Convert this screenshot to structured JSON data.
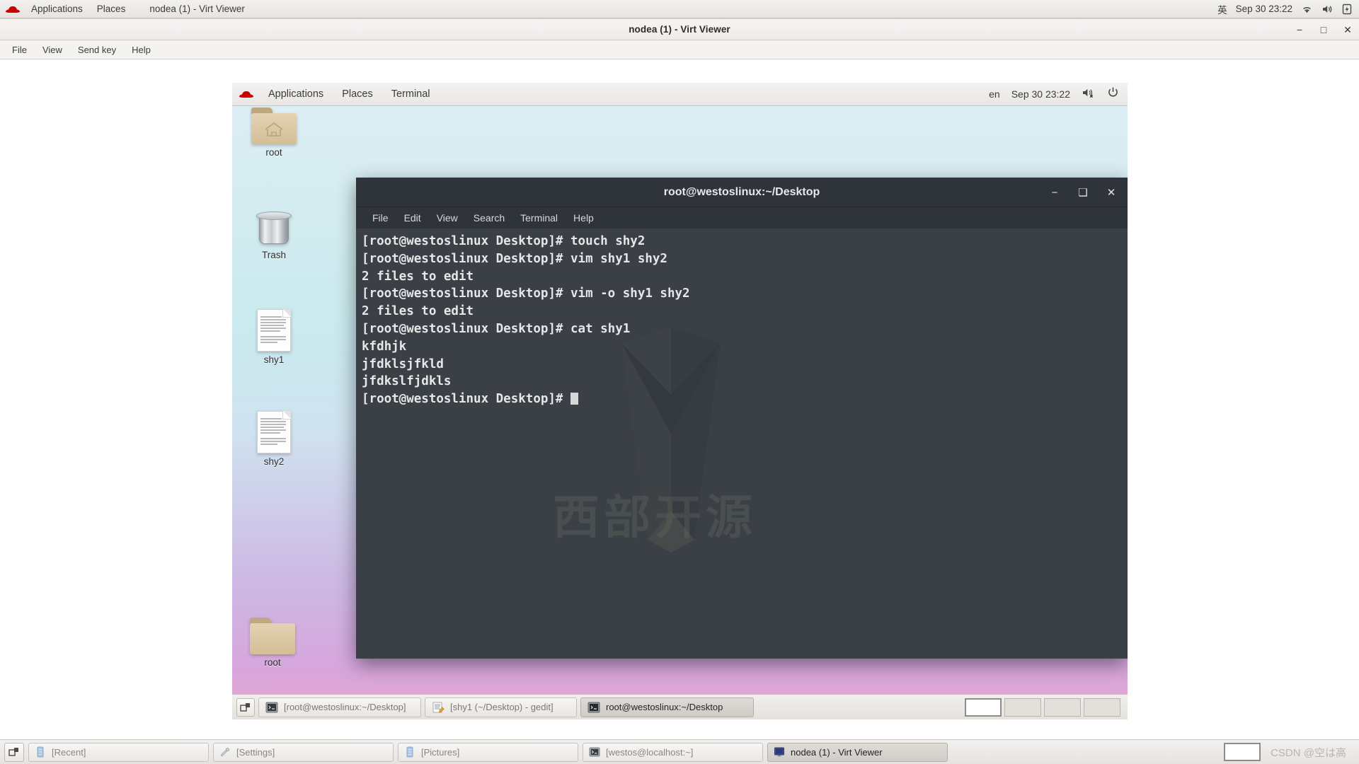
{
  "host": {
    "top_panel": {
      "logo": "redhat-logo",
      "menus": [
        "Applications",
        "Places"
      ],
      "window_title": "nodea (1) - Virt Viewer",
      "tray": {
        "input_method": "英",
        "clock": "Sep 30  23:22",
        "icons": [
          "wifi-icon",
          "volume-icon",
          "battery-icon"
        ]
      }
    },
    "taskbar": {
      "show_desktop": "show-desktop-icon",
      "tasks": [
        {
          "label": "[Recent]",
          "icon": "files-icon",
          "active": false
        },
        {
          "label": "[Settings]",
          "icon": "settings-icon",
          "active": false
        },
        {
          "label": "[Pictures]",
          "icon": "files-icon",
          "active": false
        },
        {
          "label": "[westos@localhost:~]",
          "icon": "terminal-icon",
          "active": false
        },
        {
          "label": "nodea (1) - Virt Viewer",
          "icon": "virt-viewer-icon",
          "active": true
        }
      ],
      "workspace_label": "",
      "watermark": "CSDN @空は高"
    }
  },
  "virt_viewer": {
    "title": "nodea (1) - Virt Viewer",
    "window_buttons": {
      "minimize": "−",
      "maximize": "□",
      "close": "✕"
    },
    "menus": [
      "File",
      "View",
      "Send key",
      "Help"
    ]
  },
  "vm": {
    "panel": {
      "logo": "redhat-logo",
      "menus": [
        "Applications",
        "Places",
        "Terminal"
      ],
      "tray": {
        "keyboard_layout": "en",
        "clock": "Sep 30  23:22",
        "icons": [
          "volume-muted-icon",
          "power-icon"
        ]
      }
    },
    "desktop_icons": [
      {
        "name": "root",
        "type": "home-folder-icon"
      },
      {
        "name": "Trash",
        "type": "trash-icon"
      },
      {
        "name": "shy1",
        "type": "document-icon"
      },
      {
        "name": "shy2",
        "type": "document-icon"
      },
      {
        "name": "root",
        "type": "folder-icon"
      }
    ],
    "taskbar": {
      "show_desktop": "show-desktop-icon",
      "tasks": [
        {
          "label": "[root@westoslinux:~/Desktop]",
          "icon": "terminal-icon",
          "active": false
        },
        {
          "label": "[shy1 (~/Desktop) - gedit]",
          "icon": "gedit-icon",
          "active": false
        },
        {
          "label": "root@westoslinux:~/Desktop",
          "icon": "terminal-icon",
          "active": true
        }
      ],
      "workspaces": [
        {
          "active": true
        },
        {
          "active": false
        },
        {
          "active": false
        },
        {
          "active": false
        }
      ]
    }
  },
  "terminal": {
    "title": "root@westoslinux:~/Desktop",
    "window_buttons": {
      "minimize": "−",
      "maximize": "❑",
      "close": "✕"
    },
    "menus": [
      "File",
      "Edit",
      "View",
      "Search",
      "Terminal",
      "Help"
    ],
    "watermark_text": "西部开源",
    "prompt": "[root@westoslinux Desktop]# ",
    "lines": [
      {
        "type": "prompt",
        "command": "touch shy2"
      },
      {
        "type": "prompt",
        "command": "vim shy1 shy2"
      },
      {
        "type": "output",
        "text": "2 files to edit"
      },
      {
        "type": "prompt",
        "command": "vim -o shy1 shy2"
      },
      {
        "type": "output",
        "text": "2 files to edit"
      },
      {
        "type": "prompt",
        "command": "cat shy1"
      },
      {
        "type": "output",
        "text": "kfdhjk"
      },
      {
        "type": "output",
        "text": "jfdklsjfkld"
      },
      {
        "type": "output",
        "text": "jfdkslfjdkls"
      },
      {
        "type": "prompt",
        "command": "",
        "cursor": true
      }
    ]
  },
  "colors": {
    "terminal_bg": "#3b4047",
    "terminal_titlebar": "#2f343a",
    "terminal_fg": "#e6e6e6",
    "panel_bg": "#eceae7",
    "accent_red": "#cc0000"
  }
}
